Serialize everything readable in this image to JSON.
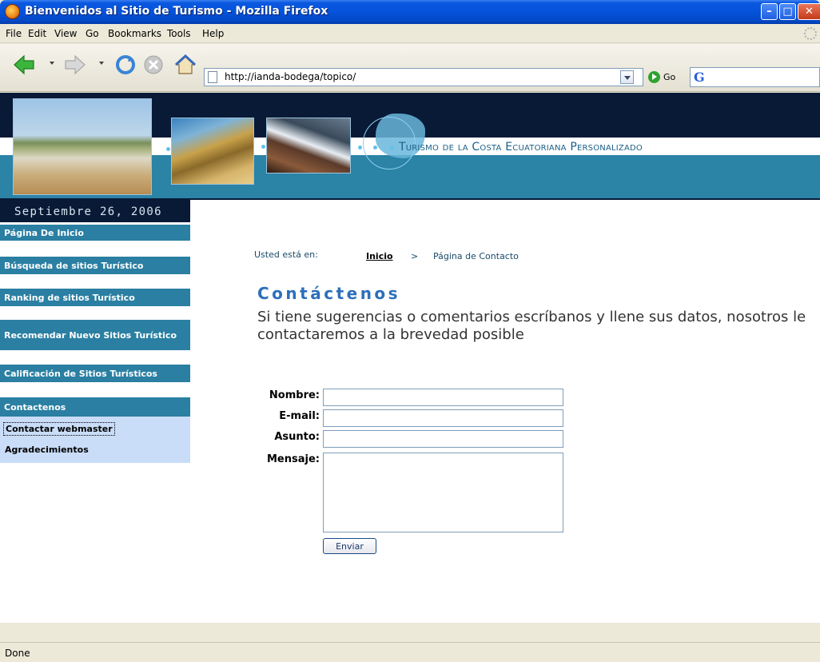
{
  "window": {
    "title": "Bienvenidos al Sitio de Turismo - Mozilla Firefox",
    "min_symbol": "–",
    "max_symbol": "□",
    "close_symbol": "✕"
  },
  "menubar": {
    "items": [
      {
        "label": "File"
      },
      {
        "label": "Edit"
      },
      {
        "label": "View"
      },
      {
        "label": "Go"
      },
      {
        "label": "Bookmarks"
      },
      {
        "label": "Tools"
      },
      {
        "label": "Help"
      }
    ]
  },
  "toolbar": {
    "url": "http://ianda-bodega/topico/",
    "go_label": "Go",
    "search_engine_glyph": "G"
  },
  "banner": {
    "tagline": "Turismo de la Costa Ecuatoriana Personalizado",
    "date": "Septiembre 26, 2006"
  },
  "sidebar": {
    "items": [
      {
        "label": "Página De Inicio"
      },
      {
        "label": "Búsqueda de sitios Turístico"
      },
      {
        "label": "Ranking de sitios Turístico"
      },
      {
        "label": "Recomendar Nuevo Sitios Turístico"
      },
      {
        "label": "Calificación de Sitios Turísticos"
      },
      {
        "label": "Contactenos"
      }
    ],
    "submenu": [
      {
        "label": "Contactar webmaster"
      },
      {
        "label": "Agradecimientos"
      }
    ]
  },
  "breadcrumb": {
    "prefix": "Usted está en:",
    "home": "Inicio",
    "separator": ">",
    "current": "Página de Contacto"
  },
  "content": {
    "title": "Contáctenos",
    "intro": "Si tiene sugerencias o comentarios escríbanos y llene sus datos, nosotros le contactaremos a la brevedad posible"
  },
  "form": {
    "name_label": "Nombre:",
    "email_label": "E-mail:",
    "subject_label": "Asunto:",
    "message_label": "Mensaje:",
    "name_value": "",
    "email_value": "",
    "subject_value": "",
    "message_value": "",
    "submit_label": "Enviar"
  },
  "scrollbar": {
    "left_arrow": "◀",
    "right_arrow": "▶"
  },
  "status": {
    "text": "Done"
  },
  "colors": {
    "title_bar": "#0553db",
    "banner_dark": "#081a36",
    "banner_band": "#2b83a6",
    "sidebar_item": "#2a7fa2",
    "submenu_bg": "#c9dcf8",
    "heading_blue": "#2c6fbc"
  }
}
